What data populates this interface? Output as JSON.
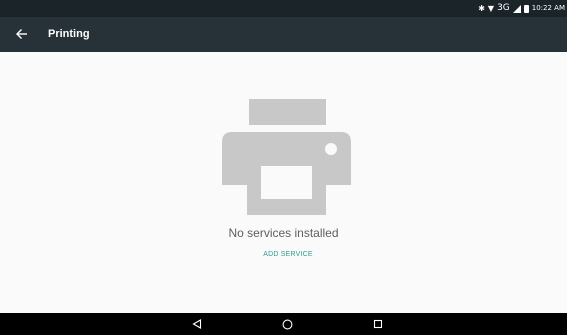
{
  "status_bar": {
    "bluetooth_icon": "bluetooth-icon",
    "wifi_icon": "wifi-icon",
    "network_label": "3G",
    "signal_icon": "signal-icon",
    "battery_icon": "battery-icon",
    "time": "10:22 AM"
  },
  "app_bar": {
    "back_icon": "arrow-back-icon",
    "title": "Printing"
  },
  "main": {
    "printer_icon": "printer-icon",
    "empty_message": "No services installed",
    "add_service_label": "ADD SERVICE"
  },
  "nav_bar": {
    "back_icon": "triangle-back-icon",
    "home_icon": "circle-home-icon",
    "recents_icon": "square-recents-icon"
  },
  "colors": {
    "status_bar_bg": "#1b2429",
    "app_bar_bg": "#263238",
    "content_bg": "#fafafa",
    "icon_gray": "#c8c8c8",
    "accent": "#2a9d8f",
    "nav_bar_bg": "#000000"
  }
}
